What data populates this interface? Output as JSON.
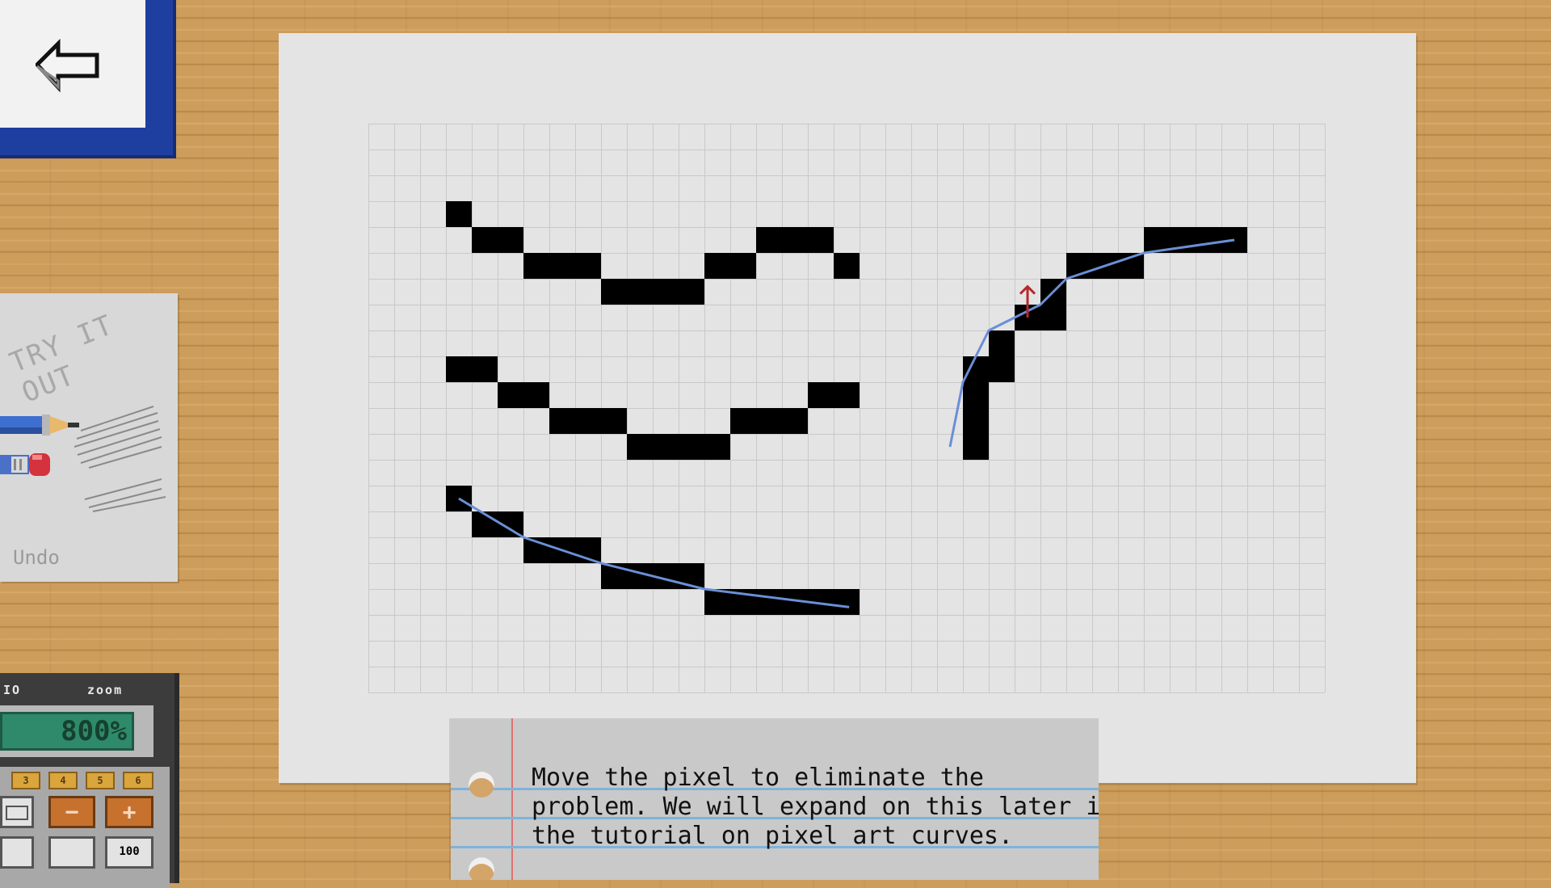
{
  "app": {
    "screen": "Pixel art tutorial"
  },
  "back_button": {
    "icon": "back-arrow-icon"
  },
  "tryout_panel": {
    "label": "TRY IT OUT",
    "undo_label": "Undo",
    "pencil_icon": "pencil-icon",
    "eraser_icon": "eraser-icon"
  },
  "calculator": {
    "left_label": "IO",
    "right_label": "zoom",
    "zoom_value": "800%",
    "top_keys": [
      "3",
      "4",
      "5",
      "6"
    ],
    "minus_label": "−",
    "plus_label": "+",
    "bottom_key": "100"
  },
  "canvas": {
    "grid_cols": 37,
    "grid_rows": 22,
    "colors": {
      "pixel": "#000000",
      "guide": "#6a8fd6",
      "arrow": "#b5282e",
      "grid": "#c9c9c9"
    }
  },
  "instruction": {
    "lines": [
      "Move the pixel to eliminate the",
      "problem. We will expand on this later in",
      "the tutorial on pixel art curves."
    ]
  }
}
